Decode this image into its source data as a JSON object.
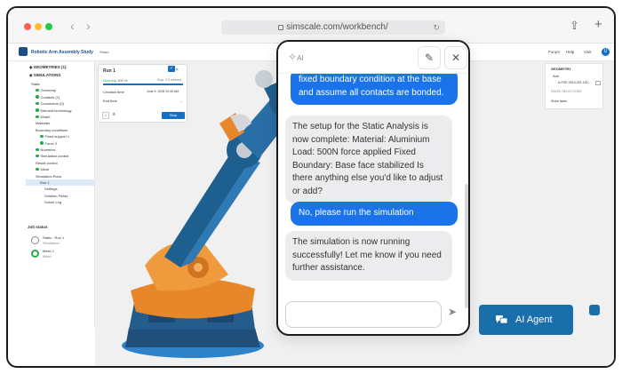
{
  "browser": {
    "url": "simscale.com/workbench/",
    "back_icon": "chevron-left-icon",
    "forward_icon": "chevron-right-icon"
  },
  "appbar": {
    "project_title": "Robotic Arm Assembly Study",
    "share_label": "Share",
    "forum_label": "Forum",
    "help_label": "Help",
    "user_label": "Visit"
  },
  "left_panel": {
    "geometries_label": "GEOMETRIES (1)",
    "simulations_label": "SIMULATIONS",
    "tree": [
      {
        "label": "Static",
        "indent": 0,
        "check": false
      },
      {
        "label": "Geometry",
        "indent": 1,
        "check": true
      },
      {
        "label": "Contacts (1)",
        "indent": 1,
        "check": true
      },
      {
        "label": "Connectors (0)",
        "indent": 1,
        "check": true
      },
      {
        "label": "Element technology",
        "indent": 1,
        "check": true
      },
      {
        "label": "Model",
        "indent": 1,
        "check": true
      },
      {
        "label": "Materials",
        "indent": 1,
        "check": false
      },
      {
        "label": "Boundary conditions",
        "indent": 1,
        "check": false
      },
      {
        "label": "Fixed support 1",
        "indent": 2,
        "check": true
      },
      {
        "label": "Force 2",
        "indent": 2,
        "check": true
      },
      {
        "label": "Numerics",
        "indent": 1,
        "check": true
      },
      {
        "label": "Simulation control",
        "indent": 1,
        "check": true
      },
      {
        "label": "Result control",
        "indent": 1,
        "check": false
      },
      {
        "label": "Mesh",
        "indent": 1,
        "check": true
      },
      {
        "label": "Simulation Runs",
        "indent": 1,
        "check": false
      },
      {
        "label": "Run 1",
        "indent": 2,
        "check": false,
        "selected": true
      },
      {
        "label": "Settings",
        "indent": 3,
        "check": false
      },
      {
        "label": "Solution Fields",
        "indent": 3,
        "check": false
      },
      {
        "label": "Solver Log",
        "indent": 3,
        "check": false
      }
    ],
    "job_status_label": "Job status",
    "jobs": [
      {
        "name": "Static - Run 1",
        "sub": "Simulation",
        "done": false
      },
      {
        "name": "Mesh 1",
        "sub": "Mesh",
        "done": true
      }
    ]
  },
  "run_card": {
    "title": "Run 1",
    "status": "Running",
    "progress_text": "100 %",
    "elapsed": "Elap: 0:0 minutes",
    "progress": 1.0,
    "creation_label": "Creation time",
    "creation_value": "June 9, 2025 10:40 AM",
    "end_label": "End time",
    "end_value": "–",
    "stop_label": "Stop"
  },
  "right_panel": {
    "title": "GEOMETRY",
    "item1": "Arm",
    "item2": "A-FGE-0910-001 100-...",
    "saved_label": "SAVED SELECTIONS",
    "show_faces": "Show faces"
  },
  "chat": {
    "ai_label": "AI",
    "messages": [
      {
        "role": "user",
        "text": "fixed boundary condition at the base and assume all contacts are bonded."
      },
      {
        "role": "bot",
        "text": "The setup for the Static Analysis is now complete: Material: Aluminium Load: 500N force applied Fixed Boundary: Base face stabilized Is there anything else you'd like to adjust or add?"
      },
      {
        "role": "user",
        "text": "No, please run the simulation"
      },
      {
        "role": "bot",
        "text": "The simulation is now running successfully! Let me know if you need further assistance."
      }
    ],
    "input_placeholder": ""
  },
  "agent_button": {
    "label": "AI Agent"
  },
  "colors": {
    "accent": "#1570c4",
    "user_bubble": "#1a73e8",
    "agent_button": "#1a6fab",
    "robot_blue": "#1d5f8f",
    "robot_orange": "#e8862a"
  }
}
